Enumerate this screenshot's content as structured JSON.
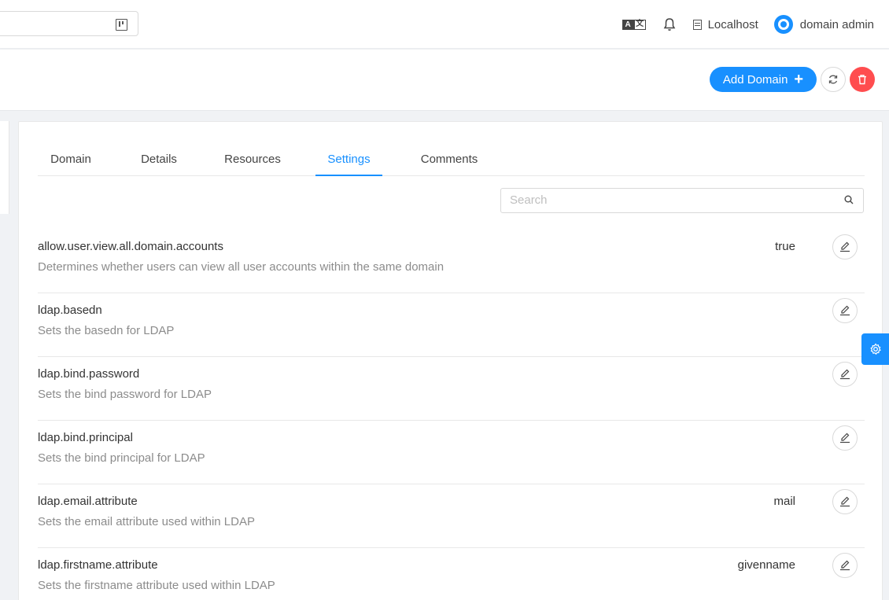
{
  "header": {
    "project": "Localhost",
    "user": "domain admin",
    "icons": [
      "translate-icon",
      "bell-icon",
      "project-icon",
      "user-avatar-icon"
    ]
  },
  "actions": {
    "add_label": "Add Domain",
    "add_icon": "plus-icon",
    "refresh_icon": "sync-icon",
    "delete_icon": "trash-icon",
    "accent": "#1890ff",
    "danger": "#ff4d4f"
  },
  "tabs": [
    {
      "label": "Domain",
      "active": false
    },
    {
      "label": "Details",
      "active": false
    },
    {
      "label": "Resources",
      "active": false
    },
    {
      "label": "Settings",
      "active": true
    },
    {
      "label": "Comments",
      "active": false
    }
  ],
  "search": {
    "placeholder": "Search"
  },
  "settings": [
    {
      "name": "allow.user.view.all.domain.accounts",
      "description": "Determines whether users can view all user accounts within the same domain",
      "value": "true"
    },
    {
      "name": "ldap.basedn",
      "description": "Sets the basedn for LDAP",
      "value": ""
    },
    {
      "name": "ldap.bind.password",
      "description": "Sets the bind password for LDAP",
      "value": ""
    },
    {
      "name": "ldap.bind.principal",
      "description": "Sets the bind principal for LDAP",
      "value": ""
    },
    {
      "name": "ldap.email.attribute",
      "description": "Sets the email attribute used within LDAP",
      "value": "mail"
    },
    {
      "name": "ldap.firstname.attribute",
      "description": "Sets the firstname attribute used within LDAP",
      "value": "givenname"
    }
  ]
}
